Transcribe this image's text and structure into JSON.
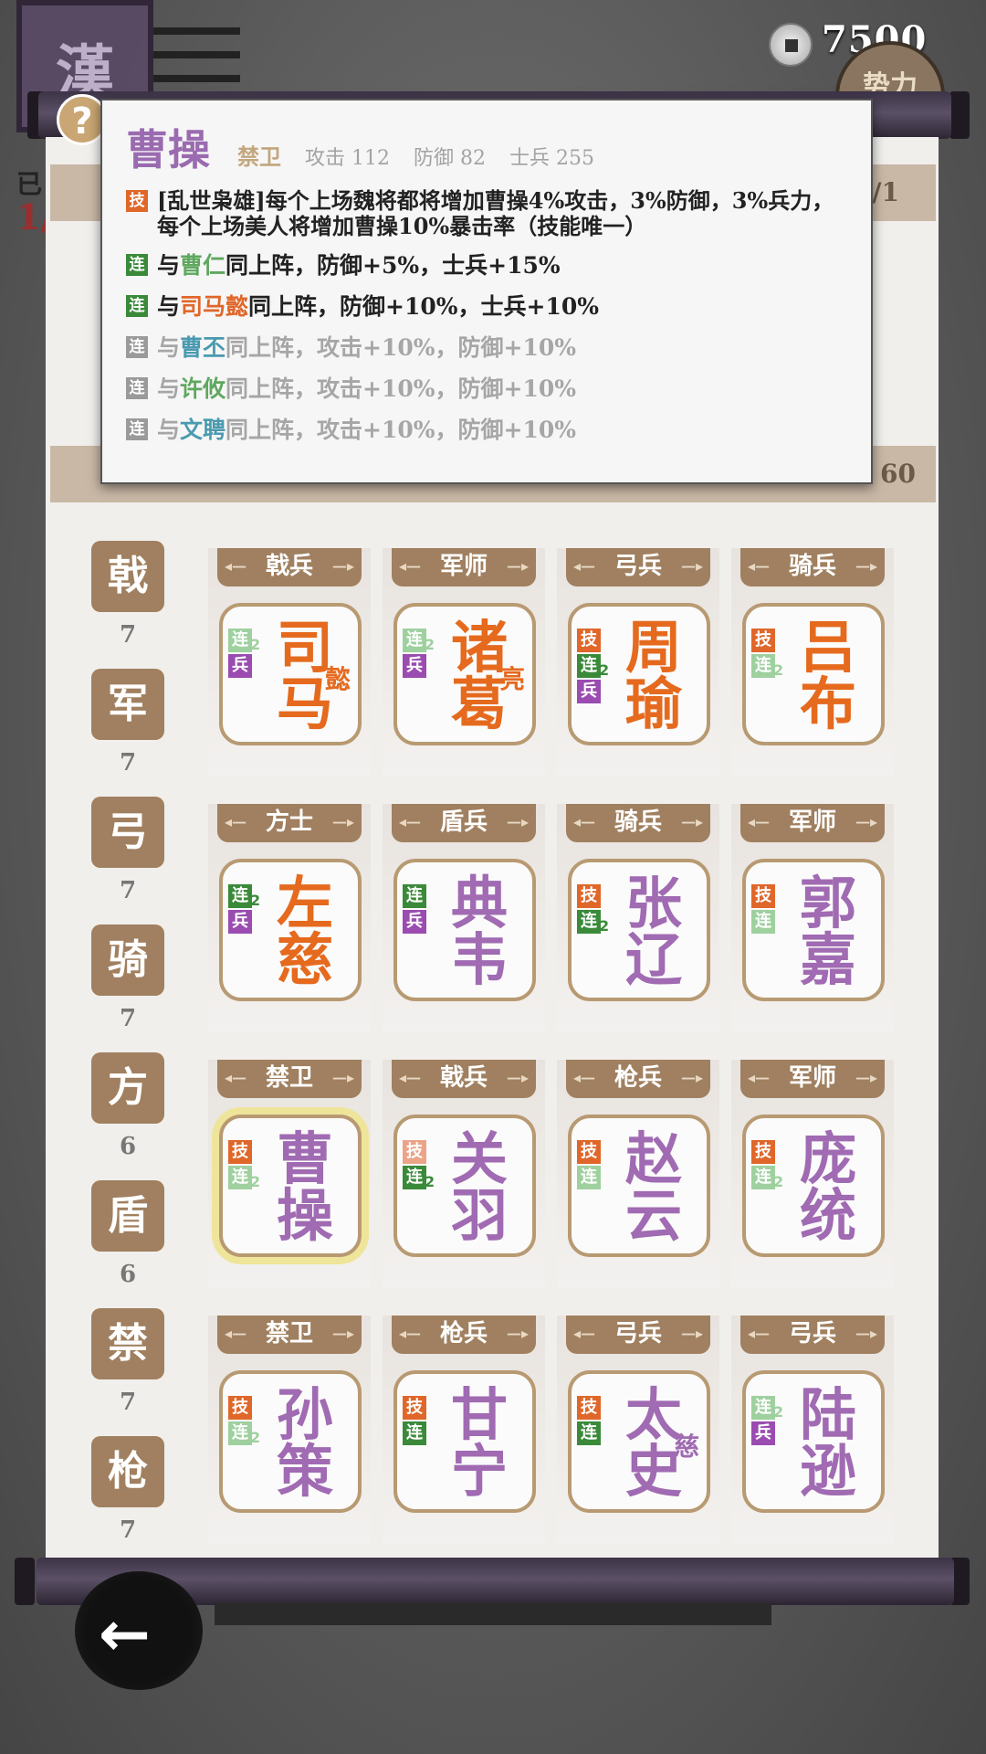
{
  "currency": {
    "icon": "coin-icon",
    "amount": "7500"
  },
  "faction_button": {
    "label": "势力"
  },
  "banner": {
    "text": "漢"
  },
  "help": {
    "label": "?"
  },
  "background_text": {
    "left_top": "已",
    "left_count": "1/",
    "band_right": "1/1",
    "band2_right": "60"
  },
  "popup": {
    "name": "曹操",
    "class": "禁卫",
    "attack": "攻击 112",
    "defense": "防御 82",
    "soldiers": "士兵 255",
    "skill_tag": "技",
    "skill_text": "[乱世枭雄]每个上场魏将都将增加曹操4%攻击，3%防御，3%兵力，每个上场美人将增加曹操10%暴击率（技能唯一）",
    "links": [
      {
        "tag": "连",
        "pre": "与",
        "name": "曹仁",
        "post": "同上阵，防御+5%，士兵+15%",
        "active": true,
        "color": "green"
      },
      {
        "tag": "连",
        "pre": "与",
        "name": "司马懿",
        "post": "同上阵，防御+10%，士兵+10%",
        "active": true,
        "color": "orange"
      },
      {
        "tag": "连",
        "pre": "与",
        "name": "曹丕",
        "post": "同上阵，攻击+10%，防御+10%",
        "active": false,
        "color": "teal"
      },
      {
        "tag": "连",
        "pre": "与",
        "name": "许攸",
        "post": "同上阵，攻击+10%，防御+10%",
        "active": false,
        "color": "green"
      },
      {
        "tag": "连",
        "pre": "与",
        "name": "文聘",
        "post": "同上阵，攻击+10%，防御+10%",
        "active": false,
        "color": "teal"
      }
    ]
  },
  "categories": [
    {
      "label": "戟",
      "count": "7"
    },
    {
      "label": "军",
      "count": "7"
    },
    {
      "label": "弓",
      "count": "7"
    },
    {
      "label": "骑",
      "count": "7"
    },
    {
      "label": "方",
      "count": "6"
    },
    {
      "label": "盾",
      "count": "6"
    },
    {
      "label": "禁",
      "count": "7"
    },
    {
      "label": "枪",
      "count": "7"
    }
  ],
  "cards": [
    {
      "class": "戟兵",
      "line1": "司",
      "line2": "马",
      "sub": "懿",
      "color": "orange",
      "tags": [
        "link-faint:2",
        "troop"
      ]
    },
    {
      "class": "军师",
      "line1": "诸",
      "line2": "葛",
      "sub": "亮",
      "color": "orange",
      "tags": [
        "link-faint:2",
        "troop"
      ]
    },
    {
      "class": "弓兵",
      "line1": "周",
      "line2": "瑜",
      "sub": "",
      "color": "orange",
      "tags": [
        "skill",
        "link:2",
        "troop"
      ]
    },
    {
      "class": "骑兵",
      "line1": "吕",
      "line2": "布",
      "sub": "",
      "color": "orange",
      "tags": [
        "skill",
        "link-faint:2"
      ]
    },
    {
      "class": "方士",
      "line1": "左",
      "line2": "慈",
      "sub": "",
      "color": "orange",
      "tags": [
        "link:2",
        "troop"
      ]
    },
    {
      "class": "盾兵",
      "line1": "典",
      "line2": "韦",
      "sub": "",
      "color": "purple",
      "tags": [
        "link",
        "troop"
      ]
    },
    {
      "class": "骑兵",
      "line1": "张",
      "line2": "辽",
      "sub": "",
      "color": "purple",
      "tags": [
        "skill",
        "link:2"
      ]
    },
    {
      "class": "军师",
      "line1": "郭",
      "line2": "嘉",
      "sub": "",
      "color": "purple",
      "tags": [
        "skill",
        "link-faint"
      ]
    },
    {
      "class": "禁卫",
      "line1": "曹",
      "line2": "操",
      "sub": "",
      "color": "purple",
      "tags": [
        "skill",
        "link-faint:2"
      ],
      "selected": true
    },
    {
      "class": "戟兵",
      "line1": "关",
      "line2": "羽",
      "sub": "",
      "color": "purple",
      "tags": [
        "skill-faint",
        "link:2"
      ]
    },
    {
      "class": "枪兵",
      "line1": "赵",
      "line2": "云",
      "sub": "",
      "color": "purple",
      "tags": [
        "skill",
        "link-faint"
      ]
    },
    {
      "class": "军师",
      "line1": "庞",
      "line2": "统",
      "sub": "",
      "color": "purple",
      "tags": [
        "skill",
        "link-faint:2"
      ]
    },
    {
      "class": "禁卫",
      "line1": "孙",
      "line2": "策",
      "sub": "",
      "color": "purple",
      "tags": [
        "skill",
        "link-faint:2"
      ]
    },
    {
      "class": "枪兵",
      "line1": "甘",
      "line2": "宁",
      "sub": "",
      "color": "purple",
      "tags": [
        "skill",
        "link"
      ]
    },
    {
      "class": "弓兵",
      "line1": "太",
      "line2": "史",
      "sub": "慈",
      "color": "purple",
      "tags": [
        "skill",
        "link"
      ]
    },
    {
      "class": "弓兵",
      "line1": "陆",
      "line2": "逊",
      "sub": "",
      "color": "purple",
      "tags": [
        "link-faint:2",
        "troop"
      ]
    }
  ],
  "tag_glyphs": {
    "skill": "技",
    "link": "连",
    "troop": "兵"
  },
  "back": {
    "icon": "back-arrow-icon",
    "glyph": "←"
  },
  "colors": {
    "accent_brown": "#a08060",
    "orange_name": "#e56a1e",
    "purple_name": "#a06bb2"
  }
}
